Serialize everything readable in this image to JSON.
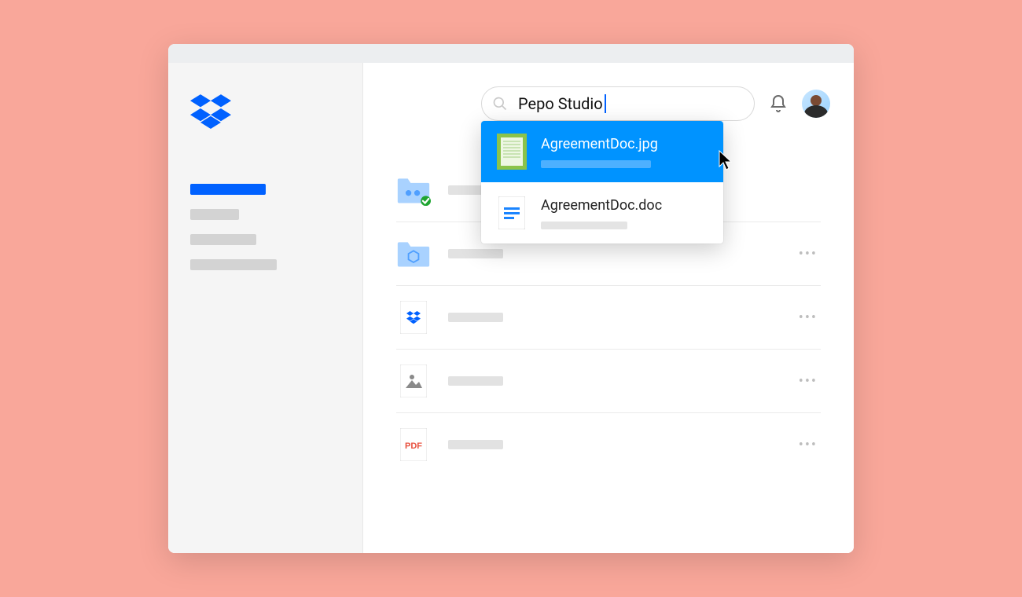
{
  "search": {
    "value": "Pepo Studio"
  },
  "dropdown": {
    "items": [
      {
        "title": "AgreementDoc.jpg",
        "selected": true,
        "kind": "image"
      },
      {
        "title": "AgreementDoc.doc",
        "selected": false,
        "kind": "doc"
      }
    ]
  },
  "files": [
    {
      "kind": "shared-folder"
    },
    {
      "kind": "folder"
    },
    {
      "kind": "dropbox-file"
    },
    {
      "kind": "image-file"
    },
    {
      "kind": "pdf-file",
      "label": "PDF"
    }
  ]
}
